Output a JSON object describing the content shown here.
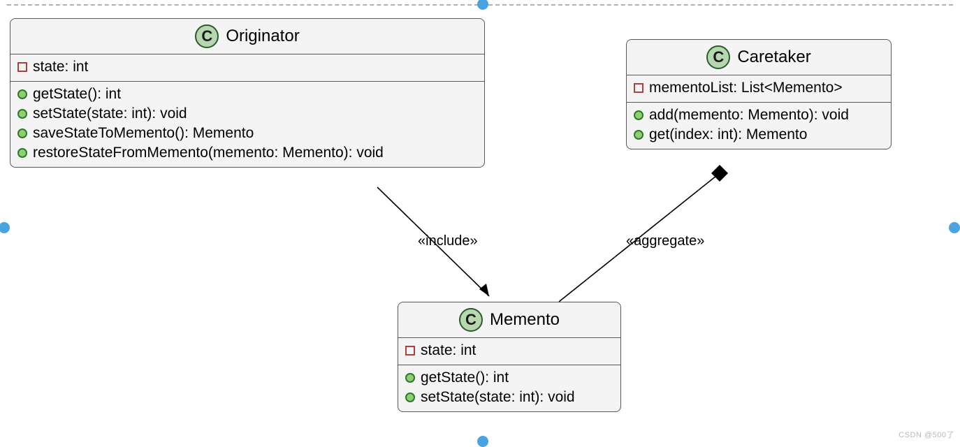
{
  "classes": {
    "originator": {
      "name": "Originator",
      "attributes": [
        {
          "text": "state: int"
        }
      ],
      "methods": [
        {
          "text": "getState(): int"
        },
        {
          "text": "setState(state: int): void"
        },
        {
          "text": "saveStateToMemento(): Memento"
        },
        {
          "text": "restoreStateFromMemento(memento: Memento): void"
        }
      ]
    },
    "caretaker": {
      "name": "Caretaker",
      "attributes": [
        {
          "text": "mementoList: List<Memento>"
        }
      ],
      "methods": [
        {
          "text": "add(memento: Memento): void"
        },
        {
          "text": "get(index: int): Memento"
        }
      ]
    },
    "memento": {
      "name": "Memento",
      "attributes": [
        {
          "text": "state: int"
        }
      ],
      "methods": [
        {
          "text": "getState(): int"
        },
        {
          "text": "setState(state: int): void"
        }
      ]
    }
  },
  "relationships": {
    "include": "«include»",
    "aggregate": "«aggregate»"
  },
  "badge_letter": "C",
  "watermark": "CSDN @500了"
}
